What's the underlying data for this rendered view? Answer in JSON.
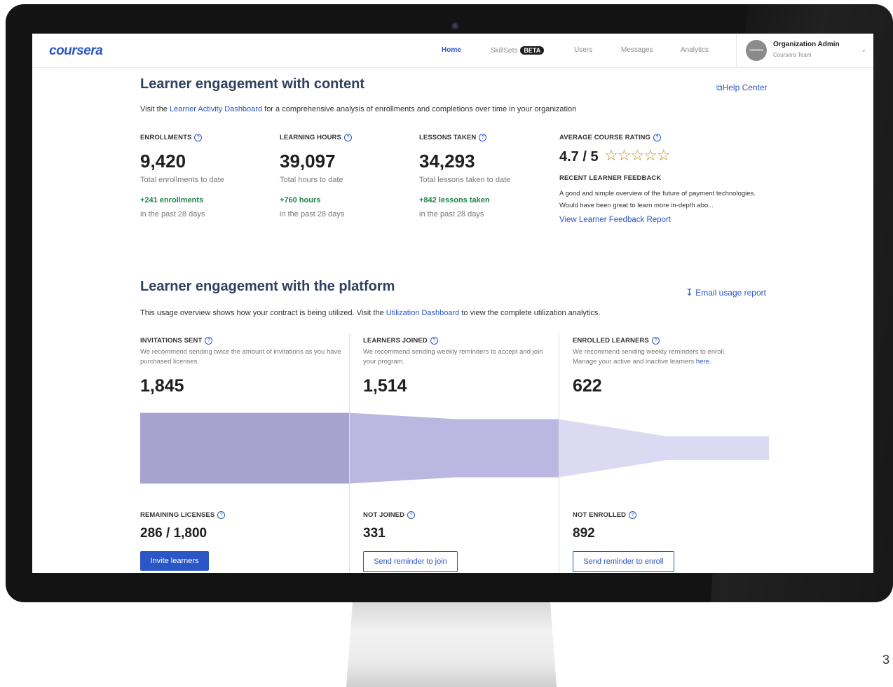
{
  "header": {
    "logo": "coursera",
    "nav": [
      {
        "label": "Home"
      },
      {
        "label": "SkillSets",
        "badge": "BETA"
      },
      {
        "label": "Users"
      },
      {
        "label": "Messages"
      },
      {
        "label": "Analytics"
      }
    ],
    "admin": {
      "avatar_text": "coursera",
      "name": "Organization Admin",
      "team": "Coursera Team"
    }
  },
  "content_section": {
    "title": "Learner engagement with content",
    "help_link": "Help Center",
    "desc_prefix": "Visit the ",
    "desc_link": "Learner Activity Dashboard",
    "desc_suffix": " for a comprehensive analysis of enrollments and completions over time in your organization",
    "kpis": [
      {
        "label": "ENROLLMENTS",
        "value": "9,420",
        "sub": "Total enrollments to date",
        "delta": "+241 enrollments",
        "period": "in the past 28 days"
      },
      {
        "label": "LEARNING HOURS",
        "value": "39,097",
        "sub": "Total hours to date",
        "delta": "+760 hours",
        "period": "in the past 28 days"
      },
      {
        "label": "LESSONS TAKEN",
        "value": "34,293",
        "sub": "Total lessons taken to date",
        "delta": "+842 lessons taken",
        "period": "in the past 28 days"
      }
    ],
    "rating": {
      "label": "AVERAGE COURSE RATING",
      "value": "4.7 / 5",
      "stars": 4.7,
      "feedback_label": "RECENT LEARNER FEEDBACK",
      "feedback_text": "A good and simple overview of the future of payment technologies. Would have been great to learn more in-depth abo...",
      "feedback_link": "View Learner Feedback Report"
    }
  },
  "platform_section": {
    "title": "Learner engagement with the platform",
    "email_link": "Email usage report",
    "desc_prefix": "This usage overview shows how your contract is being utilized. Visit the ",
    "desc_link": "Utilization Dashboard",
    "desc_suffix": " to view the complete utilization analytics.",
    "columns": [
      {
        "label": "INVITATIONS SENT",
        "desc": "We recommend sending twice the amount of invitations as you have purchased licenses.",
        "desc_link": "",
        "value": "1,845",
        "bottom_label": "REMAINING LICENSES",
        "bottom_value": "286 / 1,800",
        "button": "Invite learners"
      },
      {
        "label": "LEARNERS JOINED",
        "desc": "We recommend sending weekly reminders to accept and join your program.",
        "desc_link": "",
        "value": "1,514",
        "bottom_label": "NOT JOINED",
        "bottom_value": "331",
        "button": "Send reminder to join"
      },
      {
        "label": "ENROLLED LEARNERS",
        "desc": "We recommend sending weekly reminders to enroll. Manage your active and inactive learners ",
        "desc_link": "here.",
        "value": "622",
        "bottom_label": "NOT ENROLLED",
        "bottom_value": "892",
        "button": "Send reminder to enroll"
      }
    ],
    "funnel": {
      "values": [
        1845,
        1514,
        622
      ],
      "colors": [
        "#a7a3cf",
        "#bbb7e0",
        "#dcd9f3"
      ]
    }
  },
  "page_number": "3"
}
